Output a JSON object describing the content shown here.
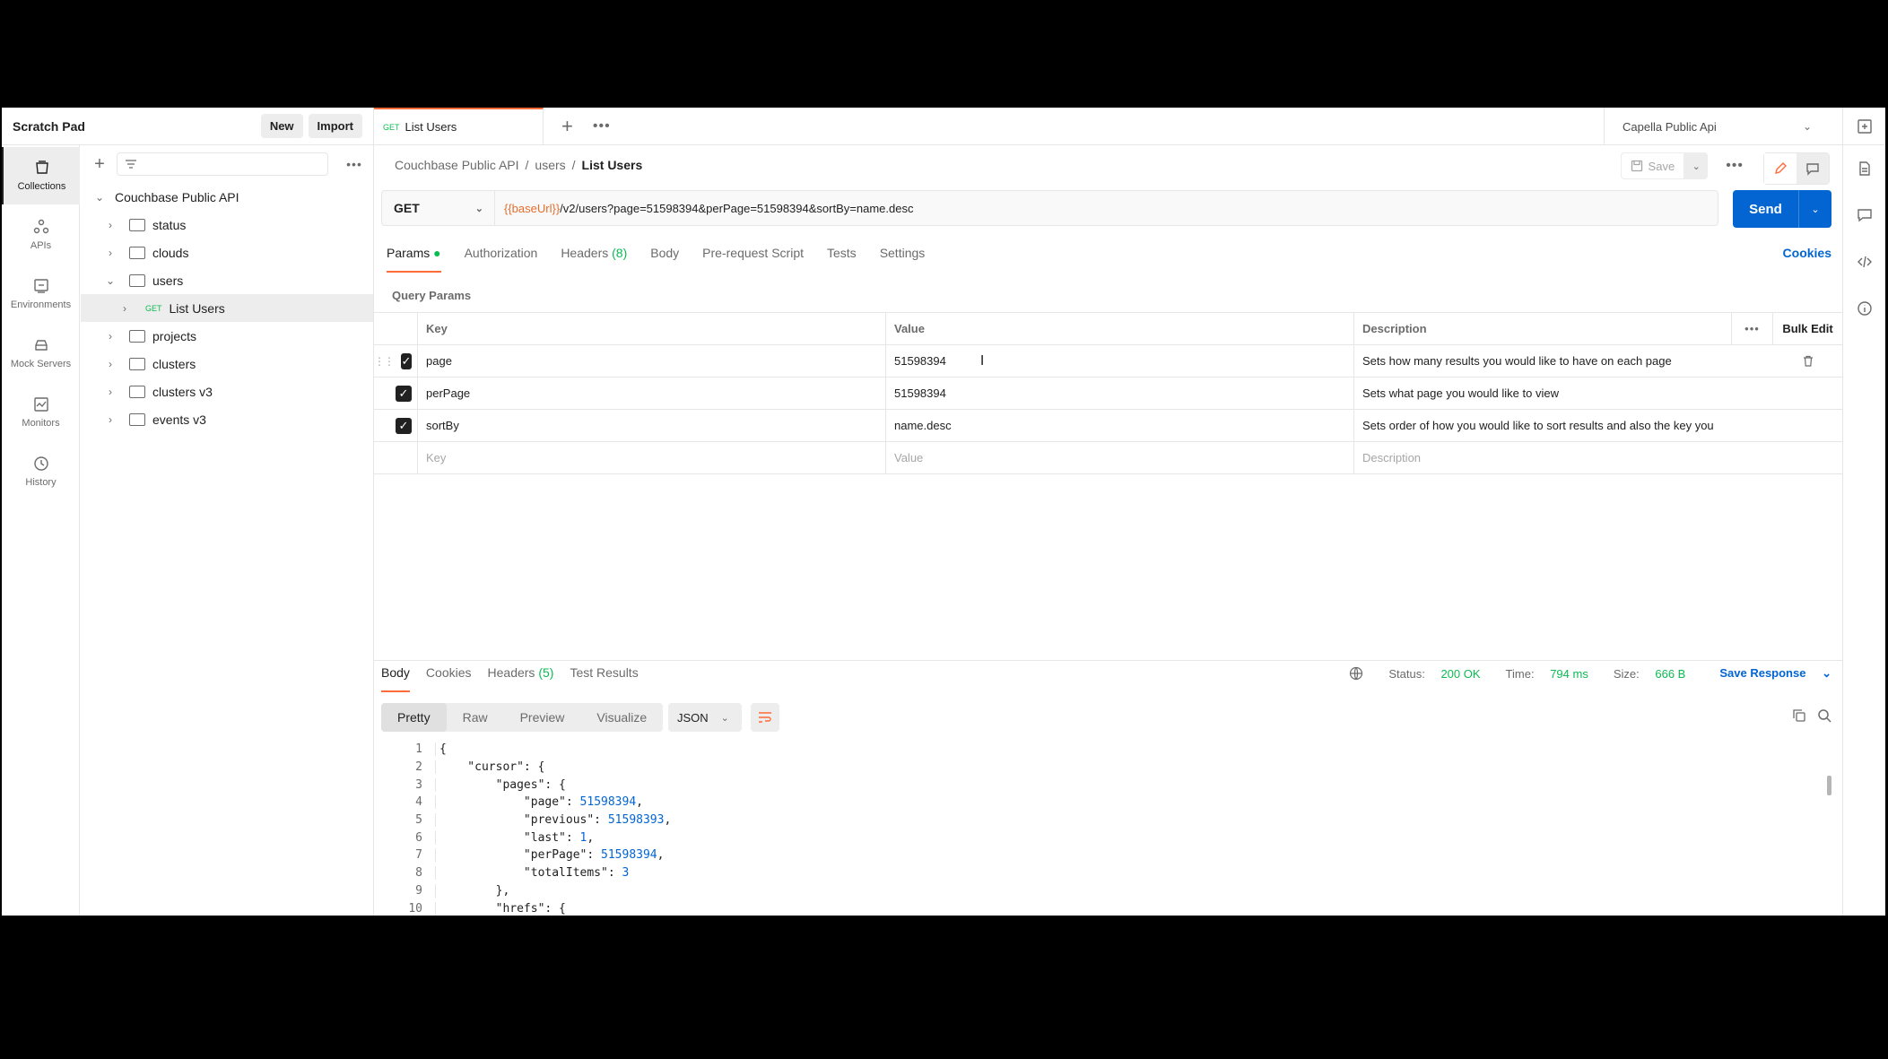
{
  "sidebar": {
    "title": "Scratch Pad",
    "new_label": "New",
    "import_label": "Import",
    "rail": [
      {
        "label": "Collections",
        "icon": "collections-icon"
      },
      {
        "label": "APIs",
        "icon": "apis-icon"
      },
      {
        "label": "Environments",
        "icon": "environments-icon"
      },
      {
        "label": "Mock Servers",
        "icon": "mock-servers-icon"
      },
      {
        "label": "Monitors",
        "icon": "monitors-icon"
      },
      {
        "label": "History",
        "icon": "history-icon"
      }
    ],
    "tree": {
      "root": "Couchbase Public API",
      "folders": [
        "status",
        "clouds",
        "users",
        "projects",
        "clusters",
        "clusters v3",
        "events v3"
      ],
      "request_method": "GET",
      "request_name": "List Users"
    }
  },
  "tab": {
    "method": "GET",
    "name": "List Users"
  },
  "environment": "Capella Public Api",
  "breadcrumb": {
    "root": "Couchbase Public API",
    "folder": "users",
    "current": "List Users"
  },
  "save_label": "Save",
  "request": {
    "method": "GET",
    "url_var": "{{baseUrl}}",
    "url_rest": "/v2/users?page=51598394&perPage=51598394&sortBy=name.desc",
    "send_label": "Send"
  },
  "req_tabs": {
    "params": "Params",
    "authorization": "Authorization",
    "headers": "Headers",
    "headers_count": "(8)",
    "body": "Body",
    "prerequest": "Pre-request Script",
    "tests": "Tests",
    "settings": "Settings",
    "cookies": "Cookies"
  },
  "query_params_label": "Query Params",
  "params_table": {
    "headers": {
      "key": "Key",
      "value": "Value",
      "description": "Description",
      "bulk_edit": "Bulk Edit"
    },
    "rows": [
      {
        "key": "page",
        "value": "51598394",
        "description": "Sets how many results you would like to have on each page"
      },
      {
        "key": "perPage",
        "value": "51598394",
        "description": "Sets what page you would like to view"
      },
      {
        "key": "sortBy",
        "value": "name.desc",
        "description": "Sets order of how you would like to sort results and also the key you"
      }
    ],
    "placeholders": {
      "key": "Key",
      "value": "Value",
      "description": "Description"
    }
  },
  "response": {
    "tabs": {
      "body": "Body",
      "cookies": "Cookies",
      "headers": "Headers",
      "headers_count": "(5)",
      "test_results": "Test Results"
    },
    "status_label": "Status:",
    "status": "200 OK",
    "time_label": "Time:",
    "time": "794 ms",
    "size_label": "Size:",
    "size": "666 B",
    "save_response": "Save Response",
    "views": [
      "Pretty",
      "Raw",
      "Preview",
      "Visualize"
    ],
    "format": "JSON",
    "code_lines": [
      {
        "n": "1",
        "t": "{"
      },
      {
        "n": "2",
        "t": "    \"cursor\": {"
      },
      {
        "n": "3",
        "t": "        \"pages\": {"
      },
      {
        "n": "4",
        "t": "            \"page\": 51598394,"
      },
      {
        "n": "5",
        "t": "            \"previous\": 51598393,"
      },
      {
        "n": "6",
        "t": "            \"last\": 1,"
      },
      {
        "n": "7",
        "t": "            \"perPage\": 51598394,"
      },
      {
        "n": "8",
        "t": "            \"totalItems\": 3"
      },
      {
        "n": "9",
        "t": "        },"
      },
      {
        "n": "10",
        "t": "        \"hrefs\": {"
      }
    ]
  }
}
